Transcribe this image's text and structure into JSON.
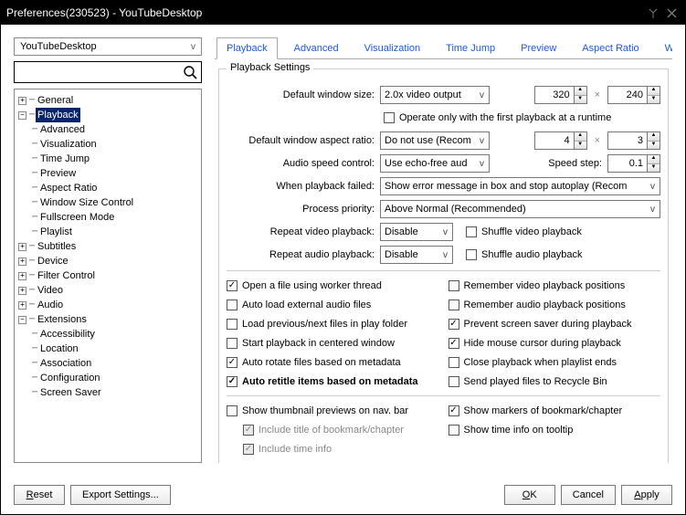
{
  "title": "Preferences(230523) - YouTubeDesktop",
  "left_dropdown": "YouTubeDesktop",
  "tree": {
    "root": [
      {
        "label": "General",
        "expand": "plus"
      },
      {
        "label": "Playback",
        "expand": "minus",
        "selected": true,
        "children": [
          {
            "label": "Advanced"
          },
          {
            "label": "Visualization"
          },
          {
            "label": "Time Jump"
          },
          {
            "label": "Preview"
          },
          {
            "label": "Aspect Ratio"
          },
          {
            "label": "Window Size Control"
          },
          {
            "label": "Fullscreen Mode"
          },
          {
            "label": "Playlist"
          }
        ]
      },
      {
        "label": "Subtitles",
        "expand": "plus"
      },
      {
        "label": "Device",
        "expand": "plus"
      },
      {
        "label": "Filter Control",
        "expand": "plus"
      },
      {
        "label": "Video",
        "expand": "plus"
      },
      {
        "label": "Audio",
        "expand": "plus"
      },
      {
        "label": "Extensions",
        "expand": "minus",
        "children": [
          {
            "label": "Accessibility"
          },
          {
            "label": "Location"
          },
          {
            "label": "Association"
          },
          {
            "label": "Configuration"
          },
          {
            "label": "Screen Saver"
          }
        ]
      }
    ]
  },
  "tabs": [
    "Playback",
    "Advanced",
    "Visualization",
    "Time Jump",
    "Preview",
    "Aspect Ratio",
    "Wir"
  ],
  "group_legend": "Playback Settings",
  "labels": {
    "default_window_size": "Default window size:",
    "operate_first": "Operate only with the first playback at a runtime",
    "default_aspect": "Default window aspect ratio:",
    "audio_speed": "Audio speed control:",
    "speed_step": "Speed step:",
    "when_failed": "When playback failed:",
    "process_priority": "Process priority:",
    "repeat_video": "Repeat video playback:",
    "repeat_audio": "Repeat audio playback:",
    "shuffle_video": "Shuffle video playback",
    "shuffle_audio": "Shuffle audio playback"
  },
  "values": {
    "default_window_size_sel": "2.0x video output",
    "size_w": "320",
    "size_h": "240",
    "default_aspect_sel": "Do not use (Recom",
    "ar_w": "4",
    "ar_h": "3",
    "audio_speed_sel": "Use echo-free aud",
    "speed_step_val": "0.1",
    "when_failed_sel": "Show error message in box and stop autoplay (Recom",
    "process_priority_sel": "Above Normal (Recommended)",
    "repeat_video_sel": "Disable",
    "repeat_audio_sel": "Disable"
  },
  "checks": {
    "left": [
      {
        "label": "Open a file using worker thread",
        "checked": true
      },
      {
        "label": "Auto load external audio files",
        "checked": false
      },
      {
        "label": "Load previous/next files in play folder",
        "checked": false
      },
      {
        "label": "Start playback in centered window",
        "checked": false
      },
      {
        "label": "Auto rotate files based on metadata",
        "checked": true
      },
      {
        "label": "Auto retitle items based on metadata",
        "checked": true,
        "bold": true
      }
    ],
    "right": [
      {
        "label": "Remember video playback positions",
        "checked": false
      },
      {
        "label": "Remember audio playback positions",
        "checked": false
      },
      {
        "label": "Prevent screen saver during playback",
        "checked": true
      },
      {
        "label": "Hide mouse cursor during playback",
        "checked": true
      },
      {
        "label": "Close playback when playlist ends",
        "checked": false
      },
      {
        "label": "Send played files to Recycle Bin",
        "checked": false
      }
    ],
    "bottom_left": [
      {
        "label": "Show thumbnail previews on nav. bar",
        "checked": false
      },
      {
        "label": "Include title of bookmark/chapter",
        "checked": true,
        "disabled": true,
        "indent": true
      },
      {
        "label": "Include time info",
        "checked": true,
        "disabled": true,
        "indent": true
      }
    ],
    "bottom_right": [
      {
        "label": "Show markers of bookmark/chapter",
        "checked": true
      },
      {
        "label": "Show time info on tooltip",
        "checked": false
      }
    ]
  },
  "footer": {
    "reset": "Reset",
    "export": "Export Settings...",
    "ok": "OK",
    "cancel": "Cancel",
    "apply": "Apply"
  }
}
